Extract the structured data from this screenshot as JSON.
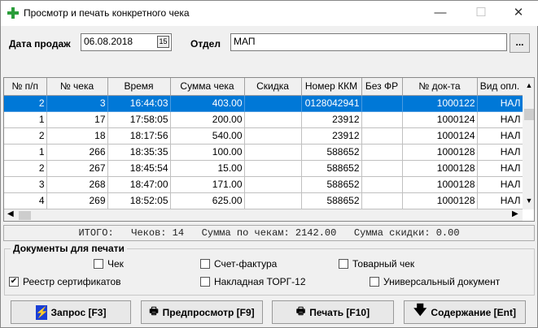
{
  "window": {
    "title": "Просмотр и печать конкретного чека",
    "minimize": "—",
    "maximize": "☐",
    "close": "✕"
  },
  "filters": {
    "date_label": "Дата продаж",
    "date_value": "06.08.2018",
    "calendar_icon": "15",
    "dept_label": "Отдел",
    "dept_value": "МАП",
    "browse_label": "..."
  },
  "table": {
    "columns": [
      "№ п/п",
      "№ чека",
      "Время",
      "Сумма чека",
      "Скидка",
      "Номер ККМ",
      "Без ФР",
      "№ док-та",
      "Вид опл."
    ],
    "rows": [
      [
        "2",
        "3",
        "16:44:03",
        "403.00",
        "",
        "0128042941",
        "",
        "1000122",
        "НАЛ"
      ],
      [
        "1",
        "17",
        "17:58:05",
        "200.00",
        "",
        "23912",
        "",
        "1000124",
        "НАЛ"
      ],
      [
        "2",
        "18",
        "18:17:56",
        "540.00",
        "",
        "23912",
        "",
        "1000124",
        "НАЛ"
      ],
      [
        "1",
        "266",
        "18:35:35",
        "100.00",
        "",
        "588652",
        "",
        "1000128",
        "НАЛ"
      ],
      [
        "2",
        "267",
        "18:45:54",
        "15.00",
        "",
        "588652",
        "",
        "1000128",
        "НАЛ"
      ],
      [
        "3",
        "268",
        "18:47:00",
        "171.00",
        "",
        "588652",
        "",
        "1000128",
        "НАЛ"
      ],
      [
        "4",
        "269",
        "18:52:05",
        "625.00",
        "",
        "588652",
        "",
        "1000128",
        "НАЛ"
      ]
    ]
  },
  "totals": "ИТОГО:   Чеков: 14   Сумма по чекам: 2142.00   Сумма скидки: 0.00",
  "print_docs": {
    "label": "Документы для печати",
    "items": [
      {
        "label": "Чек",
        "checked": false
      },
      {
        "label": "Счет-фактура",
        "checked": false
      },
      {
        "label": "Товарный чек",
        "checked": false
      },
      {
        "label": "Реестр сертификатов",
        "checked": true
      },
      {
        "label": "Накладная ТОРГ-12",
        "checked": false
      },
      {
        "label": "Универсальный документ",
        "checked": false
      }
    ]
  },
  "buttons": {
    "query": "Запрос [F3]",
    "preview": "Предпросмотр [F9]",
    "print": "Печать [F10]",
    "content": "Содержание [Ent]"
  }
}
